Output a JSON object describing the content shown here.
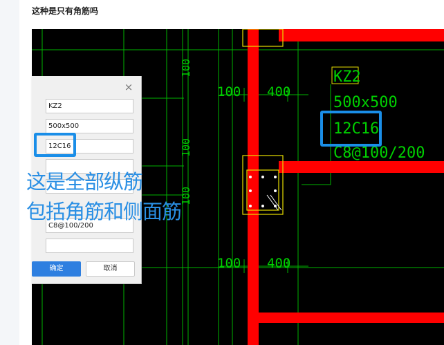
{
  "post": {
    "title": "这种是只有角筋吗"
  },
  "drawing": {
    "dims": {
      "d100_a": "100",
      "d400_a": "400",
      "d100_b": "100",
      "d400_b": "400",
      "v100_a": "100",
      "v100_b": "100",
      "v100_c": "100"
    },
    "column_label": {
      "name": "KZ2",
      "size": "500x500",
      "main_rebar": "12C16",
      "stirrup": "C8@100/200"
    }
  },
  "dialog": {
    "fields": [
      "KZ2",
      "500x500",
      "12C16",
      "",
      "",
      "C8@100/200",
      ""
    ],
    "ok_label": "确定",
    "cancel_label": "取消",
    "close_glyph": "×"
  },
  "annotation": {
    "line1": "这是全部纵筋",
    "line2": "包括角筋和侧面筋"
  },
  "colors": {
    "accent": "#1a8ee8",
    "rebar_red": "#ff0000",
    "cad_green": "#00d000",
    "cad_yellow": "#e8e000",
    "annotation_blue": "#2a8fe4"
  }
}
